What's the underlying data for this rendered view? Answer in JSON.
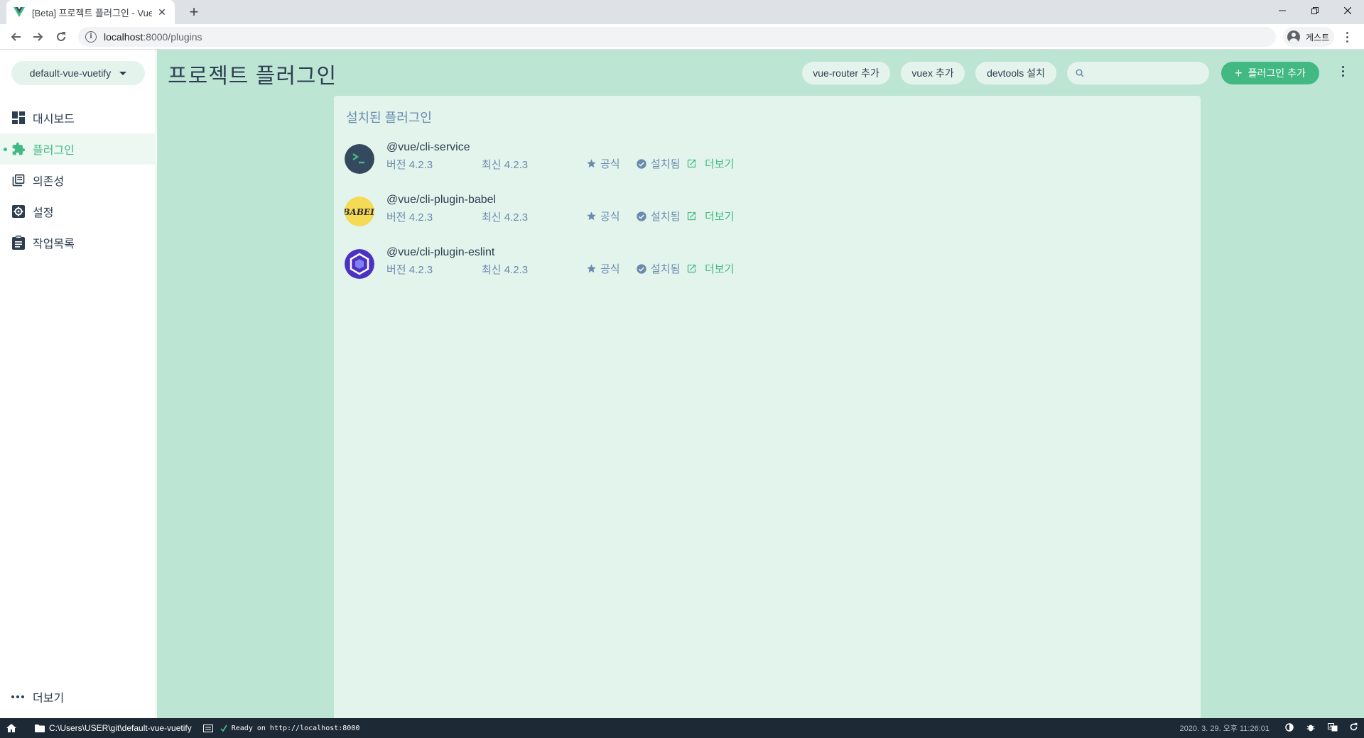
{
  "browser": {
    "tab_title": "[Beta] 프로젝트 플러그인 - Vue",
    "url_host": "localhost",
    "url_rest": ":8000/plugins",
    "profile_label": "게스트",
    "colors": {
      "tab_strip": "#dee1e6",
      "vue_green": "#42b983"
    }
  },
  "sidebar": {
    "project_name": "default-vue-vuetify",
    "items": [
      {
        "label": "대시보드",
        "icon": "dashboard-icon"
      },
      {
        "label": "플러그인",
        "icon": "puzzle-icon",
        "active": true
      },
      {
        "label": "의존성",
        "icon": "library-icon"
      },
      {
        "label": "설정",
        "icon": "gear-icon"
      },
      {
        "label": "작업목록",
        "icon": "clipboard-icon"
      }
    ],
    "more_label": "더보기"
  },
  "header": {
    "title": "프로젝트 플러그인",
    "chips": [
      "vue-router 추가",
      "vuex 추가",
      "devtools 설치"
    ],
    "search_placeholder": "",
    "add_plugin_label": "플러그인 추가"
  },
  "panel": {
    "title": "설치된 플러그인",
    "plugins": [
      {
        "name": "@vue/cli-service",
        "version": "버전 4.2.3",
        "latest": "최신 4.2.3",
        "official": "공식",
        "installed": "설치됨",
        "more": "더보기",
        "logo": "vue-cli-logo"
      },
      {
        "name": "@vue/cli-plugin-babel",
        "version": "버전 4.2.3",
        "latest": "최신 4.2.3",
        "official": "공식",
        "installed": "설치됨",
        "more": "더보기",
        "logo": "babel-logo",
        "logo_text": "BABEL"
      },
      {
        "name": "@vue/cli-plugin-eslint",
        "version": "버전 4.2.3",
        "latest": "최신 4.2.3",
        "official": "공식",
        "installed": "설치됨",
        "more": "더보기",
        "logo": "eslint-logo"
      }
    ]
  },
  "statusbar": {
    "path": "C:\\Users\\USER\\git\\default-vue-vuetify",
    "log": "Ready on http://localhost:8000",
    "datetime": "2020. 3. 29. 오후 11:26:01"
  }
}
